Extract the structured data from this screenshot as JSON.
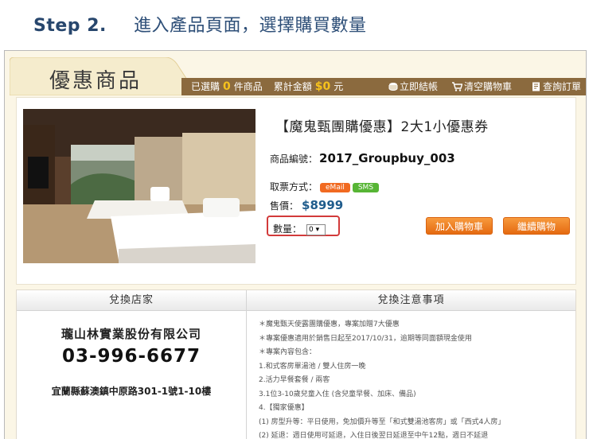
{
  "step": {
    "number": "Step 2.",
    "text": "進入產品頁面，選擇購買數量"
  },
  "header": {
    "title": "優惠商品",
    "selected_prefix": "已選購",
    "selected_count": "0",
    "selected_suffix": "件商品",
    "total_prefix": "累計金額",
    "total_amount": "$0",
    "total_suffix": "元",
    "links": {
      "checkout": "立即結帳",
      "clear_cart": "清空購物車",
      "query_orders": "查詢訂單"
    }
  },
  "product": {
    "title": "【魔鬼甄團購優惠】2大1小優惠券",
    "code_label": "商品編號：",
    "code": "2017_Groupbuy_003",
    "ticket_label": "取票方式：",
    "ticket_methods": {
      "email": "eMail",
      "sms": "SMS"
    },
    "price_label": "售價：",
    "price": "$8999",
    "qty_label": "數量：",
    "qty_value": "0",
    "add_to_cart": "加入購物車",
    "continue_shopping": "繼續購物"
  },
  "store": {
    "header": "兌換店家",
    "name": "瓏山林實業股份有限公司",
    "phone": "03-996-6677",
    "address": "宜蘭縣蘇澳鎮中原路301-1號1-10樓"
  },
  "notes": {
    "header": "兌換注意事項",
    "lines": [
      "＊魔鬼甄天使露團購優惠，專案加贈7大優惠",
      "＊專案優惠適用於銷售日起至2017/10/31，逾期等同面額現金使用",
      "＊專案內容包含：",
      "1.和式客房單湯池 / 雙人住房一晚",
      "2.活力早餐套餐 / 兩客",
      "3.1位3-10歲兒童入住 (含兒童早餐、加床、備品)",
      "4.【獨家優惠】",
      "(1) 房型升等：平日使用，免加價升等至「和式雙湯池客房」或「西式4人房」",
      "(2) 延退：週日使用可延退，入住日後翌日延退至中午12點，週日不延退"
    ]
  },
  "colors": {
    "accent_orange": "#e97a22",
    "header_brown": "#8b6a3e",
    "highlight_yellow": "#f6c21c",
    "price_blue": "#1f5c8c",
    "qty_highlight_red": "#d23a3a"
  }
}
